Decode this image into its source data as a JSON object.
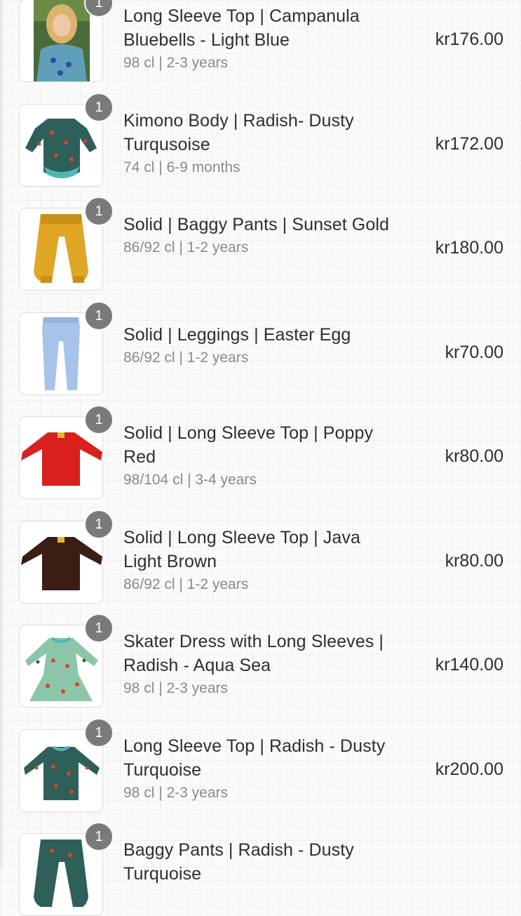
{
  "items": [
    {
      "quantity": "1",
      "title": "Long Sleeve Top | Campanula Bluebells - Light Blue",
      "variant": "98 cl | 2-3 years",
      "price": "kr176.00",
      "image": "photo-child-in-top",
      "color": "#5f9fb9"
    },
    {
      "quantity": "1",
      "title": "Kimono Body | Radish- Dusty Turqusoise",
      "variant": "74 cl | 6-9 months",
      "price": "kr172.00",
      "image": "kimono-body",
      "color": "#2e5f58"
    },
    {
      "quantity": "1",
      "title": "Solid | Baggy Pants | Sunset Gold",
      "variant": "86/92 cl | 1-2 years",
      "price": "kr180.00",
      "image": "baggy-pants",
      "color": "#e0a626"
    },
    {
      "quantity": "1",
      "title": "Solid | Leggings | Easter Egg",
      "variant": "86/92 cl | 1-2 years",
      "price": "kr70.00",
      "image": "leggings",
      "color": "#a8c3ea"
    },
    {
      "quantity": "1",
      "title": "Solid | Long Sleeve Top | Poppy Red",
      "variant": "98/104 cl | 3-4 years",
      "price": "kr80.00",
      "image": "long-sleeve-top",
      "color": "#d8201c"
    },
    {
      "quantity": "1",
      "title": "Solid | Long Sleeve Top | Java Light Brown",
      "variant": "86/92 cl | 1-2 years",
      "price": "kr80.00",
      "image": "long-sleeve-top",
      "color": "#3b1d16"
    },
    {
      "quantity": "1",
      "title": "Skater Dress with Long Sleeves | Radish - Aqua Sea",
      "variant": "98 cl | 2-3 years",
      "price": "kr140.00",
      "image": "skater-dress",
      "color": "#8cc6a8"
    },
    {
      "quantity": "1",
      "title": "Long Sleeve Top | Radish - Dusty Turquoise",
      "variant": "98 cl | 2-3 years",
      "price": "kr200.00",
      "image": "long-sleeve-top",
      "color": "#2e5f58"
    },
    {
      "quantity": "1",
      "title": "Baggy Pants | Radish - Dusty Turquoise",
      "variant": "",
      "price": "",
      "image": "baggy-pants",
      "color": "#2e5f58"
    }
  ]
}
